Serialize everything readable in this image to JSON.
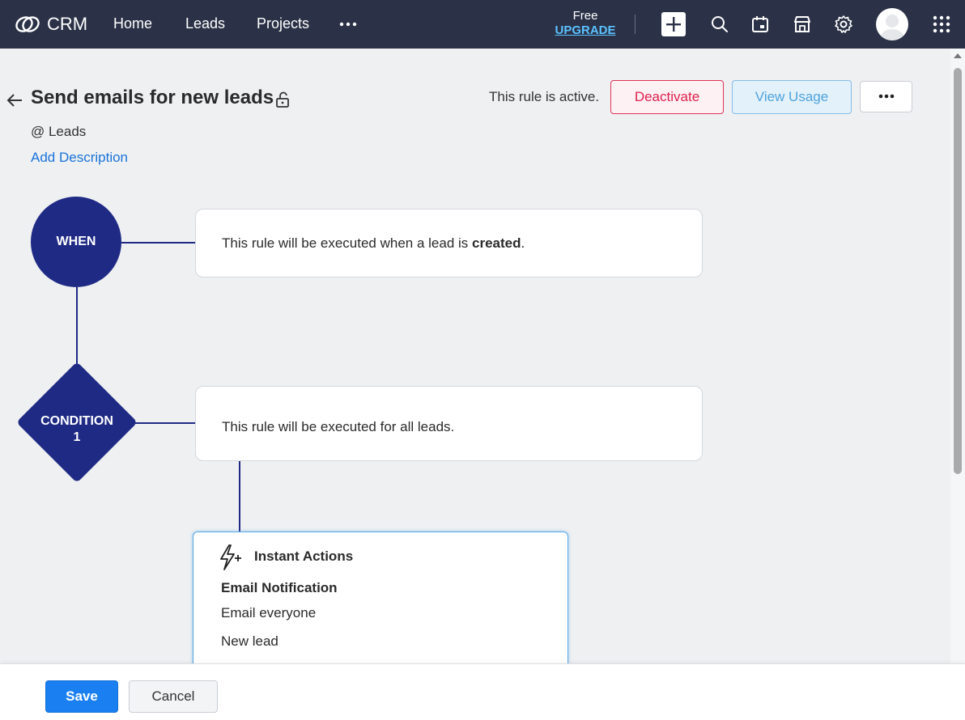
{
  "nav": {
    "brand": "CRM",
    "items": [
      {
        "label": "Home"
      },
      {
        "label": "Leads"
      },
      {
        "label": "Projects"
      }
    ],
    "more_icon": "more-horizontal-icon",
    "plan_label": "Free",
    "upgrade_label": "UPGRADE",
    "icons": [
      "plus-icon",
      "search-icon",
      "calendar-icon",
      "marketplace-icon",
      "gear-icon",
      "avatar",
      "apps-grid-icon"
    ],
    "bg_color": "#2b3247",
    "upgrade_color": "#5bc2ff"
  },
  "header": {
    "title": "Send emails for new leads",
    "module": "@ Leads",
    "add_description": "Add Description",
    "status_text": "This rule is active.",
    "deactivate_label": "Deactivate",
    "view_usage_label": "View Usage"
  },
  "flow": {
    "when_label": "WHEN",
    "when_text_prefix": "This rule will be executed when a lead is ",
    "when_text_bold": "created",
    "when_text_suffix": ".",
    "condition_label_line1": "CONDITION",
    "condition_label_line2": "1",
    "condition_text": "This rule will be executed for all leads.",
    "node_color": "#1f2a85"
  },
  "actions": {
    "title": "Instant Actions",
    "type": "Email Notification",
    "lines": [
      "Email everyone",
      "New lead"
    ]
  },
  "footer": {
    "save_label": "Save",
    "cancel_label": "Cancel"
  }
}
